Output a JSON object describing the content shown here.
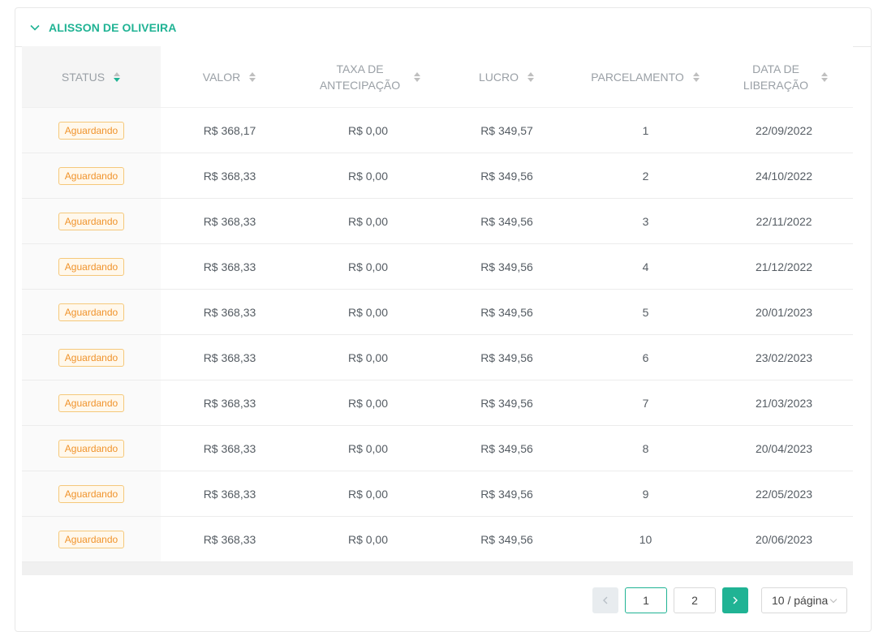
{
  "panel": {
    "title": "ALISSON DE OLIVEIRA",
    "collapse_icon": "chevron-down-icon"
  },
  "table": {
    "columns": [
      {
        "label": "STATUS",
        "sorted": "descending"
      },
      {
        "label": "VALOR",
        "sorted": "none"
      },
      {
        "label": "TAXA DE ANTECIPAÇÃO",
        "sorted": "none"
      },
      {
        "label": "LUCRO",
        "sorted": "none"
      },
      {
        "label": "PARCELAMENTO",
        "sorted": "none"
      },
      {
        "label": "DATA DE LIBERAÇÃO",
        "sorted": "none"
      }
    ],
    "rows": [
      [
        "Aguardando",
        "R$ 368,17",
        "R$ 0,00",
        "R$ 349,57",
        "1",
        "22/09/2022"
      ],
      [
        "Aguardando",
        "R$ 368,33",
        "R$ 0,00",
        "R$ 349,56",
        "2",
        "24/10/2022"
      ],
      [
        "Aguardando",
        "R$ 368,33",
        "R$ 0,00",
        "R$ 349,56",
        "3",
        "22/11/2022"
      ],
      [
        "Aguardando",
        "R$ 368,33",
        "R$ 0,00",
        "R$ 349,56",
        "4",
        "21/12/2022"
      ],
      [
        "Aguardando",
        "R$ 368,33",
        "R$ 0,00",
        "R$ 349,56",
        "5",
        "20/01/2023"
      ],
      [
        "Aguardando",
        "R$ 368,33",
        "R$ 0,00",
        "R$ 349,56",
        "6",
        "23/02/2023"
      ],
      [
        "Aguardando",
        "R$ 368,33",
        "R$ 0,00",
        "R$ 349,56",
        "7",
        "21/03/2023"
      ],
      [
        "Aguardando",
        "R$ 368,33",
        "R$ 0,00",
        "R$ 349,56",
        "8",
        "20/04/2023"
      ],
      [
        "Aguardando",
        "R$ 368,33",
        "R$ 0,00",
        "R$ 349,56",
        "9",
        "22/05/2023"
      ],
      [
        "Aguardando",
        "R$ 368,33",
        "R$ 0,00",
        "R$ 349,56",
        "10",
        "20/06/2023"
      ]
    ]
  },
  "pagination": {
    "prev_icon": "chevron-left-icon",
    "next_icon": "chevron-right-icon",
    "pages": [
      "1",
      "2"
    ],
    "current_page": "1",
    "page_size_label": "10 / página",
    "page_size_icon": "chevron-down-icon"
  },
  "colors": {
    "accent": "#20b394",
    "badge_text": "#f0932b",
    "badge_border": "#f5c87a",
    "badge_bg": "#fff8ec"
  }
}
